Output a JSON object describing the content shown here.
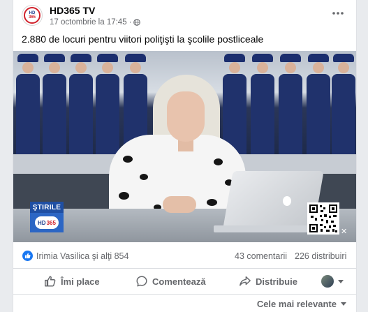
{
  "post": {
    "page_name": "HD365 TV",
    "date": "17 octombrie la 17:45",
    "separator": "·",
    "caption": "2.880 de locuri pentru viitori poliţişti la şcolile postliceale"
  },
  "avatar": {
    "hd": "HD",
    "num": "365"
  },
  "video": {
    "brand_label": "ŞTIRILE",
    "brand_hd": "HD",
    "brand_num": "365",
    "close_glyph": "✕"
  },
  "stats": {
    "reactors": "Irimia Vasilica şi alţi 854",
    "comments": "43 comentarii",
    "shares": "226 distribuiri"
  },
  "actions": {
    "like": "Îmi place",
    "comment": "Comentează",
    "share": "Distribuie"
  },
  "sort": {
    "label": "Cele mai relevante"
  },
  "colors": {
    "facebook_blue": "#1877f2",
    "secondary_text": "#65676b",
    "brand_blue": "#1f4fa3",
    "brand_red": "#d0202a"
  },
  "icons": [
    "globe-icon",
    "more-icon",
    "like-icon",
    "comment-icon",
    "share-icon",
    "chevron-down-icon"
  ]
}
